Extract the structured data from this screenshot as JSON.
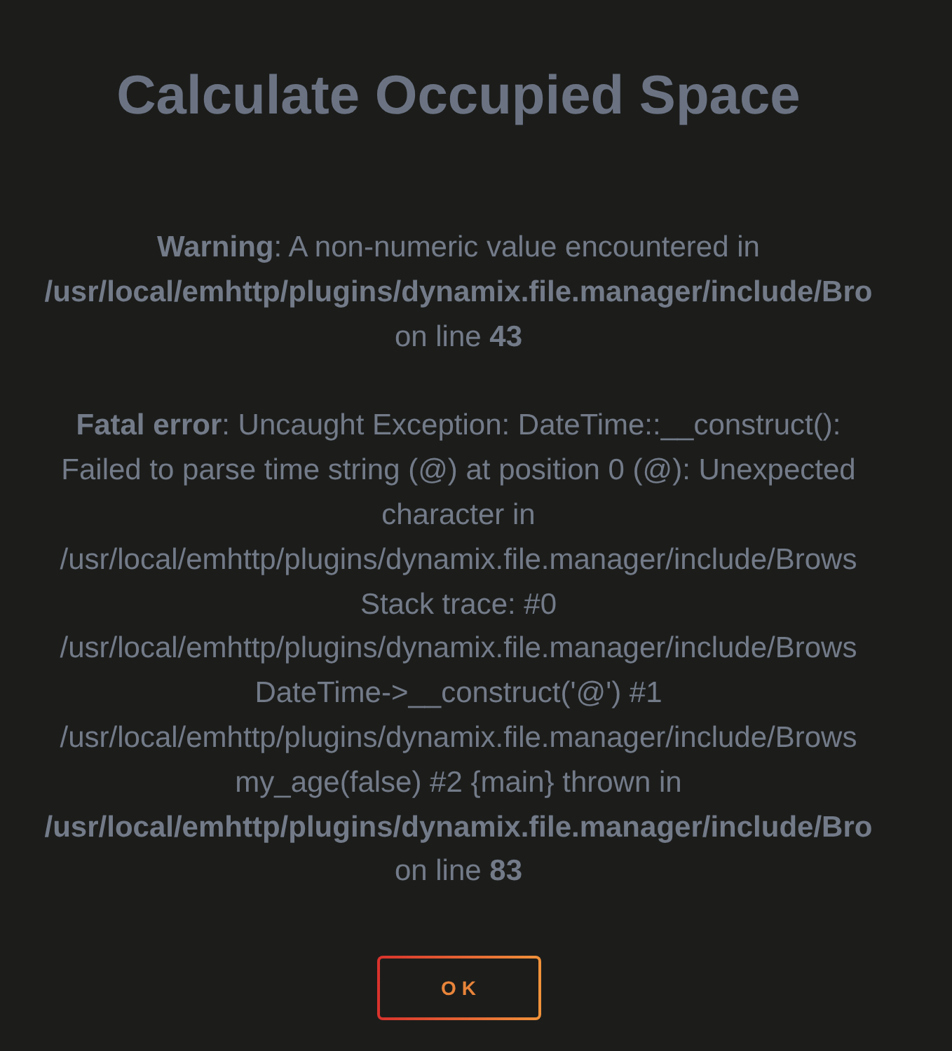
{
  "dialog": {
    "title": "Calculate Occupied Space",
    "messages": [
      {
        "lines": [
          "**Warning**: A non-numeric value encountered in",
          "**/usr/local/emhttp/plugins/dynamix.file.manager/include/Bro**",
          "on line **43**"
        ]
      },
      {
        "lines": [
          "**Fatal error**: Uncaught Exception: DateTime::__construct():",
          "Failed to parse time string (@) at position 0 (@): Unexpected",
          "character in",
          "/usr/local/emhttp/plugins/dynamix.file.manager/include/Brows",
          "Stack trace: #0",
          "/usr/local/emhttp/plugins/dynamix.file.manager/include/Brows",
          "DateTime->__construct('@') #1",
          "/usr/local/emhttp/plugins/dynamix.file.manager/include/Brows",
          "my_age(false) #2 {main} thrown in",
          "**/usr/local/emhttp/plugins/dynamix.file.manager/include/Bro**",
          "on line **83**"
        ]
      }
    ],
    "buttons": [
      {
        "label": "OK"
      }
    ]
  }
}
